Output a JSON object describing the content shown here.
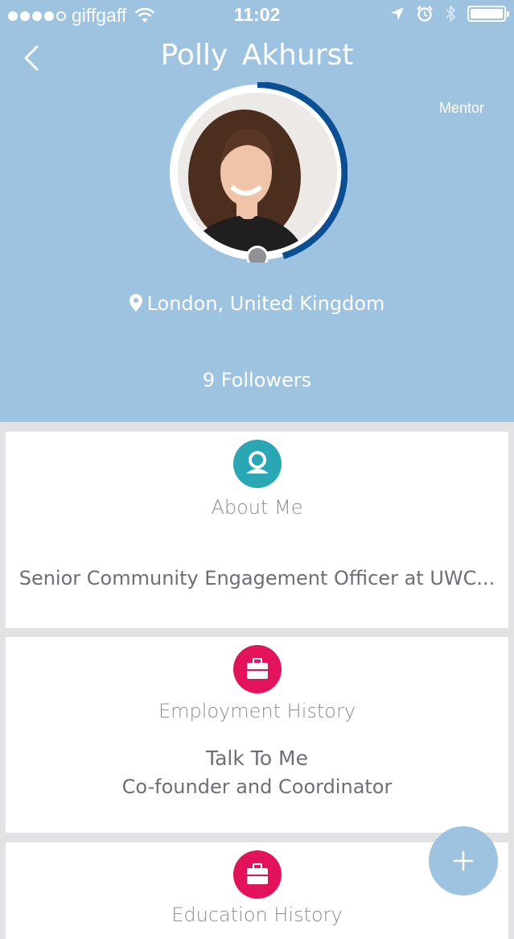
{
  "status_bar": {
    "carrier": "giffgaff",
    "time": "11:02"
  },
  "profile": {
    "name": "Polly  Akhurst",
    "role_badge": "Mentor",
    "location": "London, United Kingdom",
    "followers": "9 Followers"
  },
  "sections": {
    "about": {
      "title": "About Me",
      "text": "Senior Community Engagement Officer at UWC..."
    },
    "employment": {
      "title": "Employment History",
      "company": "Talk To Me",
      "role": "Co-founder and Coordinator"
    },
    "education": {
      "title": "Education History"
    }
  },
  "icons": {
    "back": "chevron-left-icon",
    "location": "map-pin-icon",
    "about": "user-icon",
    "employment": "briefcase-icon",
    "education": "briefcase-icon",
    "fab": "plus-icon"
  },
  "colors": {
    "header_bg": "#9dc3e1",
    "progress_ring": "#0a4f93",
    "about_icon_bg": "#2aa7b4",
    "employment_icon_bg": "#e3125a",
    "fab_bg": "#9dc3e1"
  }
}
